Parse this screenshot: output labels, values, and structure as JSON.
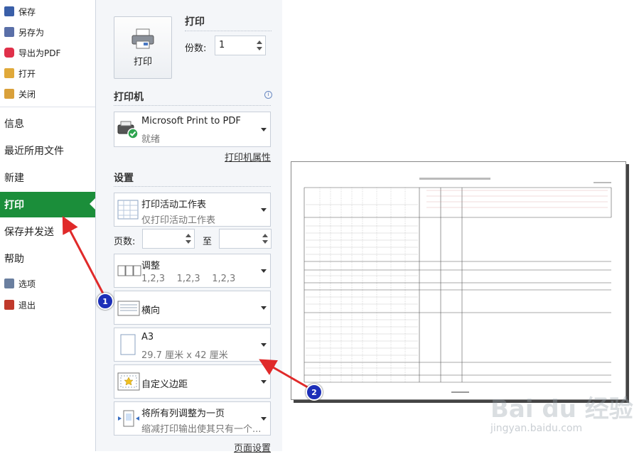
{
  "nav": {
    "small_top": [
      {
        "label": "保存",
        "icon": "save-icon",
        "color": "#3a5fa8"
      },
      {
        "label": "另存为",
        "icon": "save-as-icon",
        "color": "#5a6fa8"
      },
      {
        "label": "导出为PDF",
        "icon": "pdf-icon",
        "color": "#e0304a"
      },
      {
        "label": "打开",
        "icon": "folder-open-icon",
        "color": "#e0a93a"
      },
      {
        "label": "关闭",
        "icon": "folder-close-icon",
        "color": "#d9a03a"
      }
    ],
    "big": [
      "信息",
      "最近所用文件",
      "新建",
      "打印",
      "保存并发送",
      "帮助"
    ],
    "active": "打印",
    "small_bottom": [
      {
        "label": "选项",
        "icon": "options-icon",
        "color": "#6a7f9f"
      },
      {
        "label": "退出",
        "icon": "exit-icon",
        "color": "#c0392b"
      }
    ]
  },
  "print": {
    "title": "打印",
    "button_label": "打印",
    "copies_label": "份数:",
    "copies_value": "1"
  },
  "printer": {
    "title": "打印机",
    "name": "Microsoft Print to PDF",
    "status": "就绪",
    "properties_link": "打印机属性"
  },
  "settings": {
    "title": "设置",
    "scope_main": "打印活动工作表",
    "scope_sub": "仅打印活动工作表",
    "pages_label": "页数:",
    "to_label": "至",
    "collate_main": "调整",
    "collate_sub": "1,2,3    1,2,3    1,2,3",
    "orientation": "横向",
    "paper_main": "A3",
    "paper_sub": "29.7 厘米 x 42 厘米",
    "margins": "自定义边距",
    "scaling_main": "将所有列调整为一页",
    "scaling_sub": "缩减打印输出使其只有一个...",
    "page_setup_link": "页面设置"
  },
  "annotations": [
    "1",
    "2"
  ],
  "watermark": {
    "brand": "Bai du 经验",
    "url": "jingyan.baidu.com"
  },
  "colors": {
    "accent": "#1b8e3a",
    "arrow": "#e02a2a",
    "badge": "#1d2fb8"
  }
}
